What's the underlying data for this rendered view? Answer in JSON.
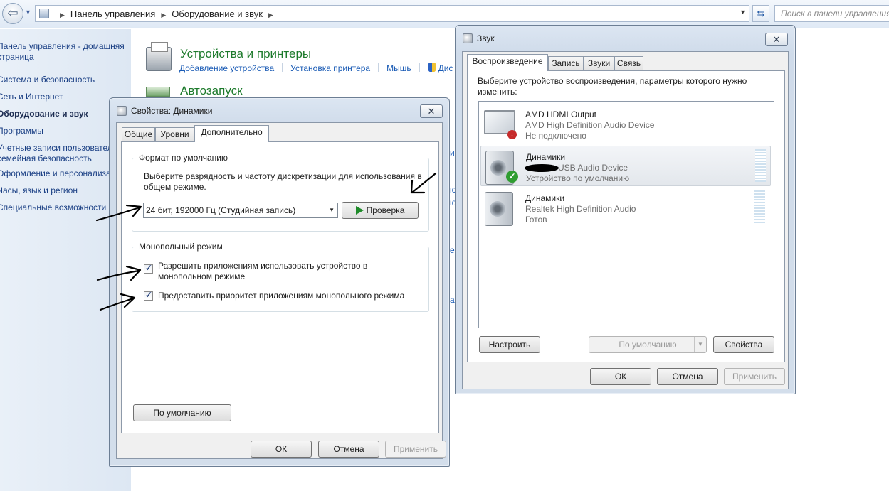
{
  "explorer": {
    "breadcrumbs": [
      "Панель управления",
      "Оборудование и звук"
    ],
    "search_placeholder": "Поиск в панели управления"
  },
  "left_nav": [
    {
      "label": "Панель управления - домашняя",
      "bold": false
    },
    {
      "label": "страница",
      "bold": false
    },
    {
      "label": "Система и безопасность",
      "bold": false
    },
    {
      "label": "Сеть и Интернет",
      "bold": false
    },
    {
      "label": "Оборудование и звук",
      "bold": true
    },
    {
      "label": "Программы",
      "bold": false
    },
    {
      "label": "Учетные записи пользовател",
      "bold": false
    },
    {
      "label": "семейная безопасность",
      "bold": false
    },
    {
      "label": "Оформление и персонализац",
      "bold": false
    },
    {
      "label": "Часы, язык и регион",
      "bold": false
    },
    {
      "label": "Специальные возможности",
      "bold": false
    }
  ],
  "main": {
    "devices_title": "Устройства и принтеры",
    "devices_links": [
      "Добавление устройства",
      "Установка принтера",
      "Мышь",
      "Дис"
    ],
    "autoplay_title": "Автозапуск",
    "edge_fragments": [
      "и",
      "ю",
      "ю",
      "е",
      "а"
    ]
  },
  "props_dialog": {
    "title": "Свойства: Динамики",
    "tabs": [
      "Общие",
      "Уровни",
      "Дополнительно"
    ],
    "active_tab": "Дополнительно",
    "format_group": "Формат по умолчанию",
    "format_desc": "Выберите разрядность и частоту дискретизации для использования в общем режиме.",
    "format_value": "24 бит, 192000 Гц (Студийная запись)",
    "test_button": "Проверка",
    "exclusive_group": "Монопольный режим",
    "checkbox1": "Разрешить приложениям использовать устройство в монопольном режиме",
    "checkbox1_checked": true,
    "checkbox2": "Предоставить приоритет приложениям монопольного режима",
    "checkbox2_checked": true,
    "defaults_button": "По умолчанию",
    "ok": "ОК",
    "cancel": "Отмена",
    "apply": "Применить"
  },
  "sound_dialog": {
    "title": "Звук",
    "tabs": [
      "Воспроизведение",
      "Запись",
      "Звуки",
      "Связь"
    ],
    "active_tab": "Воспроизведение",
    "instruction": "Выберите устройство воспроизведения, параметры которого нужно изменить:",
    "devices": [
      {
        "name": "AMD HDMI Output",
        "driver": "AMD High Definition Audio Device",
        "status": "Не подключено",
        "icon": "monitor-icon",
        "badge": "disconnected-badge-icon"
      },
      {
        "name": "Динамики",
        "driver": "USB Audio Device",
        "status": "Устройство по умолчанию",
        "icon": "speaker-icon",
        "badge": "default-check-badge-icon",
        "selected": true
      },
      {
        "name": "Динамики",
        "driver": "Realtek High Definition Audio",
        "status": "Готов",
        "icon": "speaker-icon"
      }
    ],
    "configure_button": "Настроить",
    "set_default_button": "По умолчанию",
    "properties_button": "Свойства",
    "ok": "ОК",
    "cancel": "Отмена",
    "apply": "Применить"
  },
  "colors": {
    "link": "#1a5bb5",
    "category_title": "#1c7a2b",
    "nav_link": "#1a3f84"
  }
}
